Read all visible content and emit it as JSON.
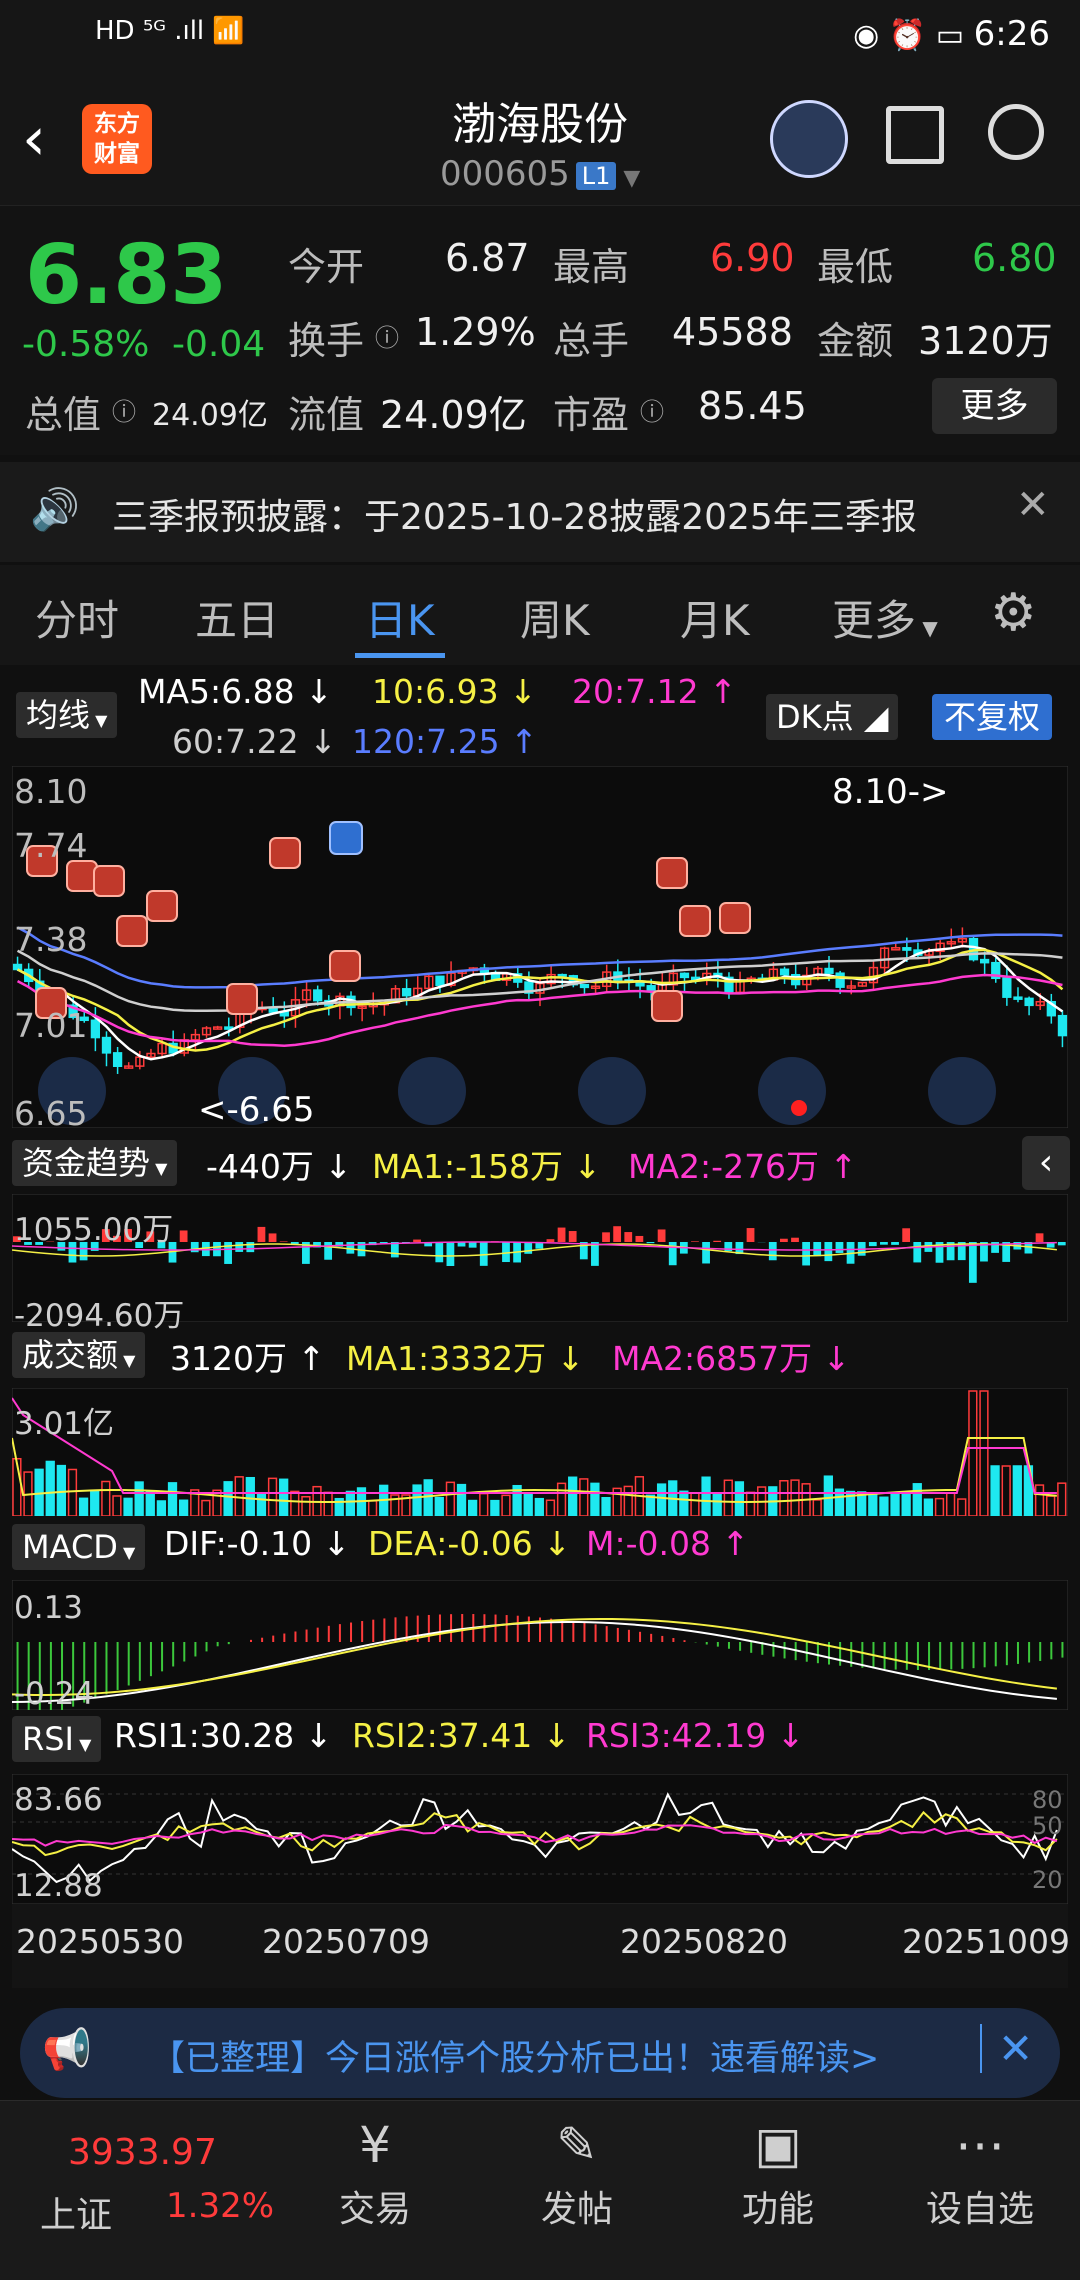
{
  "status": {
    "left": "HD ⁵ᴳ .ıll 📶",
    "time": "6:26"
  },
  "header": {
    "title": "渤海股份",
    "code": "000605",
    "badge": "L1",
    "logo": "东方\n财富"
  },
  "quote": {
    "price": "6.83",
    "pct": "-0.58%",
    "chg": "-0.04",
    "open_label": "今开",
    "open": "6.87",
    "high_label": "最高",
    "high": "6.90",
    "low_label": "最低",
    "low": "6.80",
    "turnover_label": "换手",
    "turnover": "1.29%",
    "volume_label": "总手",
    "volume": "45588",
    "amount_label": "金额",
    "amount": "3120万",
    "mktcap_label": "总值",
    "mktcap": "24.09亿",
    "float_label": "流值",
    "float": "24.09亿",
    "pe_label": "市盈",
    "pe": "85.45",
    "more": "更多"
  },
  "notice": {
    "text": "三季报预披露：于2025-10-28披露2025年三季报",
    "close": "✕"
  },
  "tabs": [
    "分时",
    "五日",
    "日K",
    "周K",
    "月K",
    "更多"
  ],
  "ma_legend": {
    "selector": "均线",
    "ma5": "MA5:6.88",
    "ma10": "10:6.93",
    "ma20": "20:7.12",
    "ma60": "60:7.22",
    "ma120": "120:7.25",
    "dk": "DK点",
    "fq": "不复权"
  },
  "main_chart": {
    "top": "8.10",
    "y2": "7.74",
    "y3": "7.38",
    "y4": "7.01",
    "bottom": "6.65",
    "hi_note": "8.10->",
    "lo_note": "<-6.65"
  },
  "fund": {
    "selector": "资金趋势",
    "val": "-440万",
    "ma1": "MA1:-158万",
    "ma2": "MA2:-276万",
    "top": "1055.00万",
    "bottom": "-2094.60万"
  },
  "turnover": {
    "selector": "成交额",
    "val": "3120万",
    "ma1": "MA1:3332万",
    "ma2": "MA2:6857万",
    "top": "3.01亿"
  },
  "macd": {
    "selector": "MACD",
    "dif": "DIF:-0.10",
    "dea": "DEA:-0.06",
    "m": "M:-0.08",
    "top": "0.13",
    "bottom": "-0.24"
  },
  "rsi": {
    "selector": "RSI",
    "r1": "RSI1:30.28",
    "r2": "RSI2:37.41",
    "r3": "RSI3:42.19",
    "top": "83.66",
    "bottom": "12.88",
    "l80": "80",
    "l50": "50",
    "l20": "20"
  },
  "dates": [
    "20250530",
    "20250709",
    "20250820",
    "20251009"
  ],
  "banner": {
    "text": "【已整理】今日涨停个股分析已出！速看解读>"
  },
  "bottom": {
    "index_value": "3933.97",
    "index_name": "上证",
    "index_pct": "1.32%",
    "nav": [
      "交易",
      "发帖",
      "功能",
      "设自选"
    ]
  },
  "colors": {
    "up": "#ff3b3b",
    "down": "#1ee8f0",
    "ma5": "#ffffff",
    "ma10": "#f5f045",
    "ma20": "#ff3ad0",
    "ma60": "#cfcfcf",
    "ma120": "#5a7dff"
  }
}
